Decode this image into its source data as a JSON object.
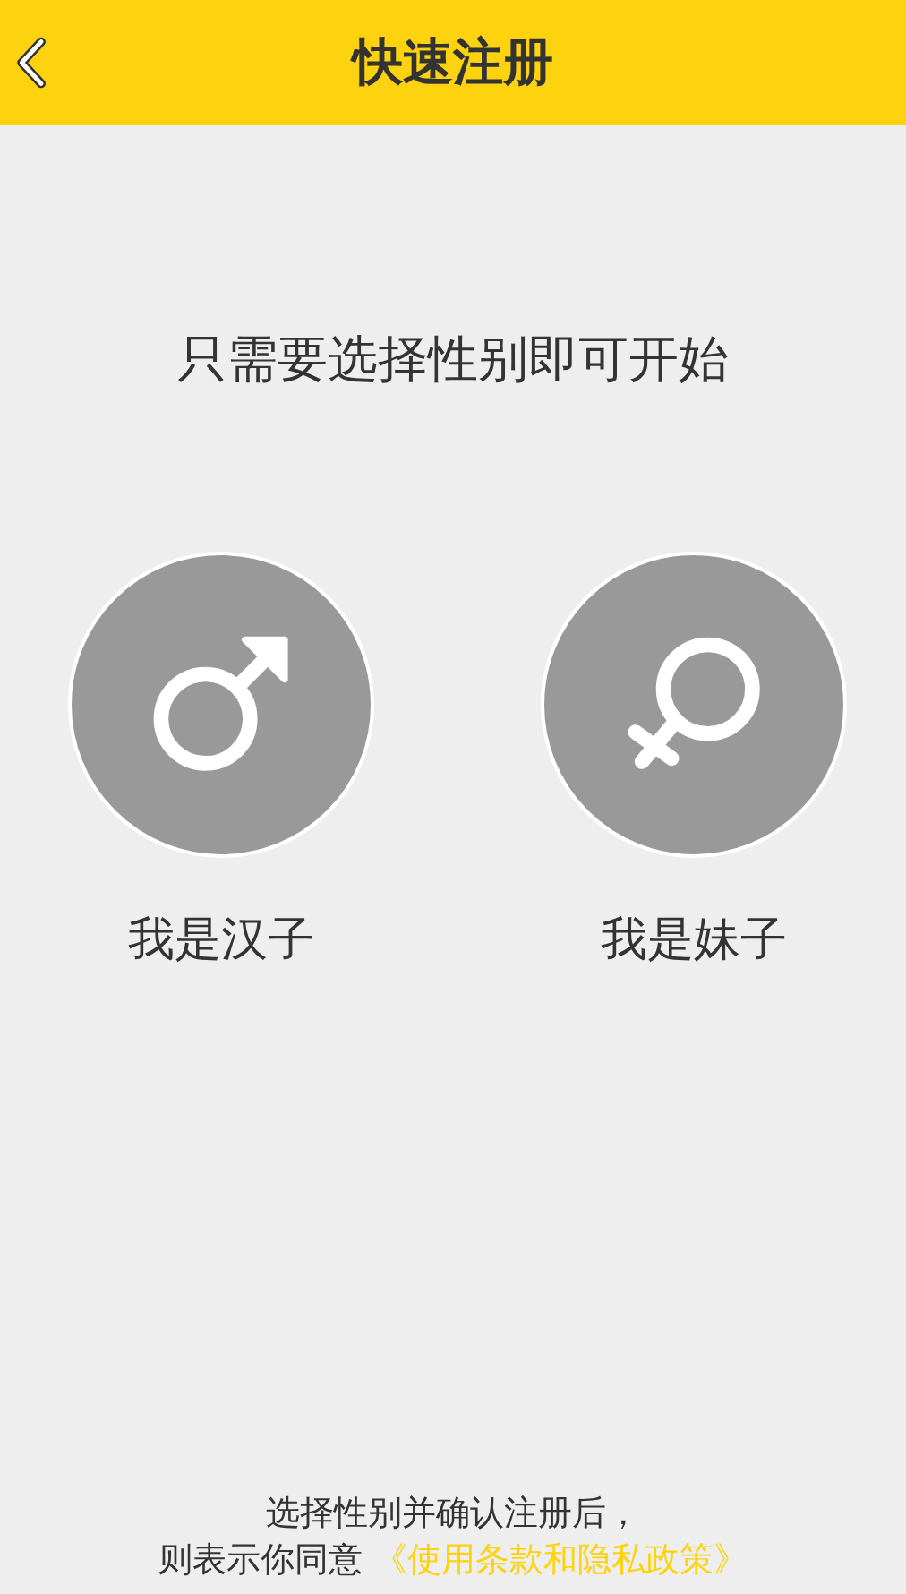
{
  "header": {
    "title": "快速注册"
  },
  "prompt": "只需要选择性别即可开始",
  "options": [
    {
      "kind": "male",
      "label": "我是汉子"
    },
    {
      "kind": "female",
      "label": "我是妹子"
    }
  ],
  "footer": {
    "line_1": "选择性别并确认注册后，",
    "line_2": "则表示你同意",
    "link": "《使用条款和隐私政策》"
  }
}
